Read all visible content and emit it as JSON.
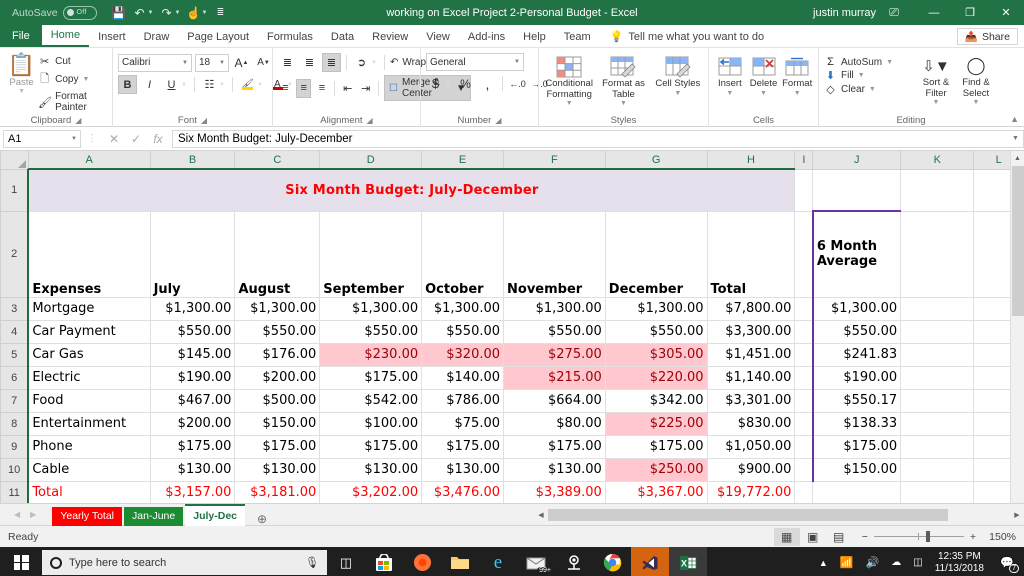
{
  "titlebar": {
    "autosave_label": "AutoSave",
    "autosave_state": "Off",
    "save_icon": "save-icon",
    "undo_icon": "undo-icon",
    "redo_icon": "redo-icon",
    "touch_icon": "touch-mode-icon",
    "more_icon": "customize-qat-icon",
    "document_title": "working on  Excel Project 2-Personal Budget  -  Excel",
    "user": "justin murray",
    "account_icon": "account-ribbon-icon",
    "minimize": "—",
    "restore": "❐",
    "close": "✕"
  },
  "ribbon_tabs": {
    "file": "File",
    "items": [
      "Home",
      "Insert",
      "Draw",
      "Page Layout",
      "Formulas",
      "Data",
      "Review",
      "View",
      "Add-ins",
      "Help",
      "Team"
    ],
    "active": "Home",
    "tellme": "Tell me what you want to do",
    "share": "Share"
  },
  "ribbon": {
    "clipboard": {
      "paste": "Paste",
      "cut": "Cut",
      "copy": "Copy",
      "format_painter": "Format Painter",
      "group": "Clipboard"
    },
    "font": {
      "font_name": "Calibri",
      "font_size": "18",
      "grow": "A",
      "shrink": "A",
      "bold": "B",
      "italic": "I",
      "underline": "U",
      "borders": "borders-icon",
      "fill_color": "fill-color-icon",
      "font_color": "font-color-icon",
      "group": "Font"
    },
    "alignment": {
      "wrap_text": "Wrap Text",
      "merge_center": "Merge & Center",
      "group": "Alignment"
    },
    "number": {
      "format": "General",
      "currency": "$",
      "percent": "%",
      "comma": ",",
      "inc_dec": "increase-decimal-icon",
      "dec_dec": "decrease-decimal-icon",
      "group": "Number"
    },
    "styles": {
      "conditional_formatting": "Conditional Formatting",
      "format_as_table": "Format as Table",
      "cell_styles": "Cell Styles",
      "group": "Styles"
    },
    "cells": {
      "insert": "Insert",
      "delete": "Delete",
      "format": "Format",
      "group": "Cells"
    },
    "editing": {
      "autosum": "AutoSum",
      "fill": "Fill",
      "clear": "Clear",
      "sort_filter": "Sort & Filter",
      "find_select": "Find & Select",
      "group": "Editing"
    }
  },
  "formula_bar": {
    "name_box": "A1",
    "cancel_icon": "cancel-icon",
    "enter_icon": "enter-icon",
    "function_icon": "insert-function-icon",
    "formula": "Six Month Budget: July-December"
  },
  "grid": {
    "columns": [
      "A",
      "B",
      "C",
      "D",
      "E",
      "F",
      "G",
      "H",
      "I",
      "J",
      "K",
      "L"
    ],
    "row_numbers": [
      "1",
      "2",
      "3",
      "4",
      "5",
      "6",
      "7",
      "8",
      "9",
      "10",
      "11"
    ],
    "title": "Six Month Budget: July-December",
    "headers": [
      "Expenses",
      "July",
      "August",
      "September",
      "October",
      "November",
      "December",
      "Total"
    ],
    "avg_header": "6 Month Average",
    "rows": [
      {
        "name": "Mortgage",
        "values": [
          "$1,300.00",
          "$1,300.00",
          "$1,300.00",
          "$1,300.00",
          "$1,300.00",
          "$1,300.00"
        ],
        "flags": [
          0,
          0,
          0,
          0,
          0,
          0
        ],
        "total": "$7,800.00",
        "avg": "$1,300.00"
      },
      {
        "name": "Car Payment",
        "values": [
          "$550.00",
          "$550.00",
          "$550.00",
          "$550.00",
          "$550.00",
          "$550.00"
        ],
        "flags": [
          0,
          0,
          0,
          0,
          0,
          0
        ],
        "total": "$3,300.00",
        "avg": "$550.00"
      },
      {
        "name": "Car Gas",
        "values": [
          "$145.00",
          "$176.00",
          "$230.00",
          "$320.00",
          "$275.00",
          "$305.00"
        ],
        "flags": [
          0,
          0,
          1,
          1,
          1,
          1
        ],
        "total": "$1,451.00",
        "avg": "$241.83"
      },
      {
        "name": "Electric",
        "values": [
          "$190.00",
          "$200.00",
          "$175.00",
          "$140.00",
          "$215.00",
          "$220.00"
        ],
        "flags": [
          0,
          0,
          0,
          0,
          1,
          1
        ],
        "total": "$1,140.00",
        "avg": "$190.00"
      },
      {
        "name": "Food",
        "values": [
          "$467.00",
          "$500.00",
          "$542.00",
          "$786.00",
          "$664.00",
          "$342.00"
        ],
        "flags": [
          0,
          0,
          0,
          0,
          0,
          0
        ],
        "total": "$3,301.00",
        "avg": "$550.17"
      },
      {
        "name": "Entertainment",
        "values": [
          "$200.00",
          "$150.00",
          "$100.00",
          "$75.00",
          "$80.00",
          "$225.00"
        ],
        "flags": [
          0,
          0,
          0,
          0,
          0,
          1
        ],
        "total": "$830.00",
        "avg": "$138.33"
      },
      {
        "name": "Phone",
        "values": [
          "$175.00",
          "$175.00",
          "$175.00",
          "$175.00",
          "$175.00",
          "$175.00"
        ],
        "flags": [
          0,
          0,
          0,
          0,
          0,
          0
        ],
        "total": "$1,050.00",
        "avg": "$175.00"
      },
      {
        "name": "Cable",
        "values": [
          "$130.00",
          "$130.00",
          "$130.00",
          "$130.00",
          "$130.00",
          "$250.00"
        ],
        "flags": [
          0,
          0,
          0,
          0,
          0,
          1
        ],
        "total": "$900.00",
        "avg": "$150.00"
      }
    ],
    "total_row": {
      "name": "Total",
      "values": [
        "$3,157.00",
        "$3,181.00",
        "$3,202.00",
        "$3,476.00",
        "$3,389.00",
        "$3,367.00"
      ],
      "total": "$19,772.00"
    },
    "colors": {
      "title_fill": "#e5e0ec",
      "title_text": "#ff0000",
      "warn_fill": "#ffc7ce",
      "warn_text": "#9c0006",
      "green_border": "#1f6b3b",
      "purple_border": "#70309f",
      "total_text": "#ff0000"
    }
  },
  "sheet_tabs": {
    "tabs": [
      {
        "label": "Yearly Total",
        "color": "#ff0000",
        "active": false
      },
      {
        "label": "Jan-June",
        "color": "#1c8b34",
        "active": false
      },
      {
        "label": "July-Dec",
        "color": "#ffffff",
        "active": true
      }
    ],
    "add_label": "+",
    "prev_icon": "prev-sheet-icon",
    "next_icon": "next-sheet-icon"
  },
  "status_bar": {
    "status": "Ready",
    "normal_view": "normal-view-icon",
    "page_layout_view": "page-layout-view-icon",
    "page_break_view": "page-break-view-icon",
    "zoom_out": "−",
    "zoom_in": "+",
    "zoom": "150%"
  },
  "taskbar": {
    "start": "start-button",
    "search_placeholder": "Type here to search",
    "mic_icon": "microphone-icon",
    "task_view": "task-view-icon",
    "apps": [
      {
        "name": "microsoft-store-icon"
      },
      {
        "name": "firefox-icon"
      },
      {
        "name": "file-explorer-icon"
      },
      {
        "name": "microsoft-edge-icon"
      },
      {
        "name": "mail-icon",
        "badge": "99+"
      },
      {
        "name": "zoom-icon"
      },
      {
        "name": "google-chrome-icon"
      },
      {
        "name": "visual-studio-code-icon"
      },
      {
        "name": "excel-icon"
      }
    ],
    "tray": {
      "chevron": "show-hidden-icons",
      "wifi": "wifi-icon",
      "volume": "volume-icon",
      "onedrive": "onedrive-icon",
      "touchpad": "touchpad-icon",
      "time": "12:35 PM",
      "date": "11/13/2018",
      "notifications": "action-center-icon",
      "notif_count": "7"
    }
  }
}
